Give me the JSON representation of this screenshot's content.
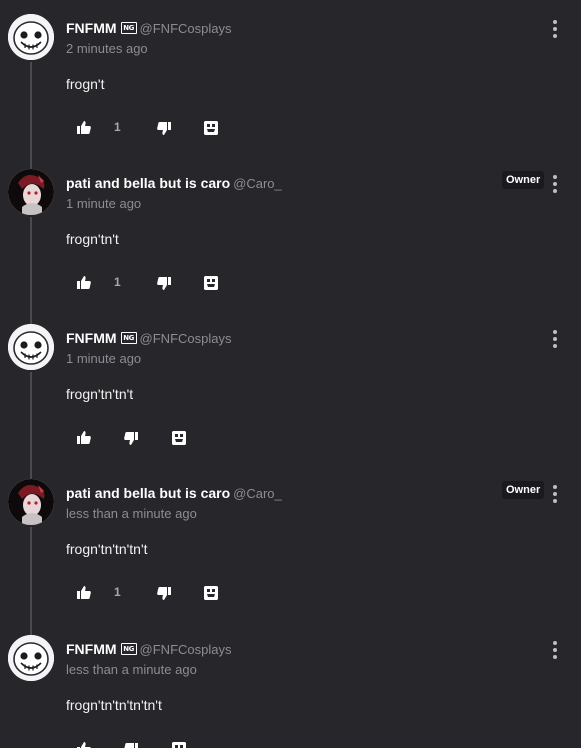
{
  "colors": {
    "background": "#26262b",
    "text": "#ffffff",
    "muted": "#8c8c94",
    "thread_line": "#4a4a52"
  },
  "comments": [
    {
      "username": "FNFMM",
      "handle": "@FNFCosplays",
      "has_ng_badge": true,
      "ng_badge_text": "NG",
      "timestamp": "2 minutes ago",
      "body": "frogn't",
      "like_count": "1",
      "owner_badge": "",
      "avatar_icon": "skull-avatar-icon"
    },
    {
      "username": "pati and bella but is caro",
      "handle": "@Caro_",
      "has_ng_badge": false,
      "timestamp": "1 minute ago",
      "body": "frogn'tn't",
      "like_count": "1",
      "owner_badge": "Owner",
      "avatar_icon": "character-avatar-icon"
    },
    {
      "username": "FNFMM",
      "handle": "@FNFCosplays",
      "has_ng_badge": true,
      "ng_badge_text": "NG",
      "timestamp": "1 minute ago",
      "body": "frogn'tn'tn't",
      "like_count": "",
      "owner_badge": "",
      "avatar_icon": "skull-avatar-icon"
    },
    {
      "username": "pati and bella but is caro",
      "handle": "@Caro_",
      "has_ng_badge": false,
      "timestamp": "less than a minute ago",
      "body": "frogn'tn'tn'tn't",
      "like_count": "1",
      "owner_badge": "Owner",
      "avatar_icon": "character-avatar-icon"
    },
    {
      "username": "FNFMM",
      "handle": "@FNFCosplays",
      "has_ng_badge": true,
      "ng_badge_text": "NG",
      "timestamp": "less than a minute ago",
      "body": "frogn'tn'tn'tn'tn't",
      "like_count": "",
      "owner_badge": "",
      "avatar_icon": "skull-avatar-icon"
    }
  ]
}
